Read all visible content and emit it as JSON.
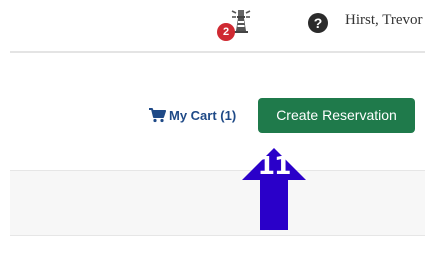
{
  "header": {
    "notification_count": "2",
    "help_glyph": "?",
    "user_name": "Hirst, Trevor"
  },
  "actions": {
    "cart_label": "My Cart (1)",
    "create_label": "Create Reservation"
  },
  "annotation": {
    "step_number": "11",
    "arrow_color": "#2a00c9"
  },
  "colors": {
    "create_button": "#1f7a4b",
    "cart_link": "#1f4a87",
    "badge": "#cf2a32"
  },
  "icons": [
    "lighthouse-icon",
    "help-icon",
    "cart-icon"
  ]
}
